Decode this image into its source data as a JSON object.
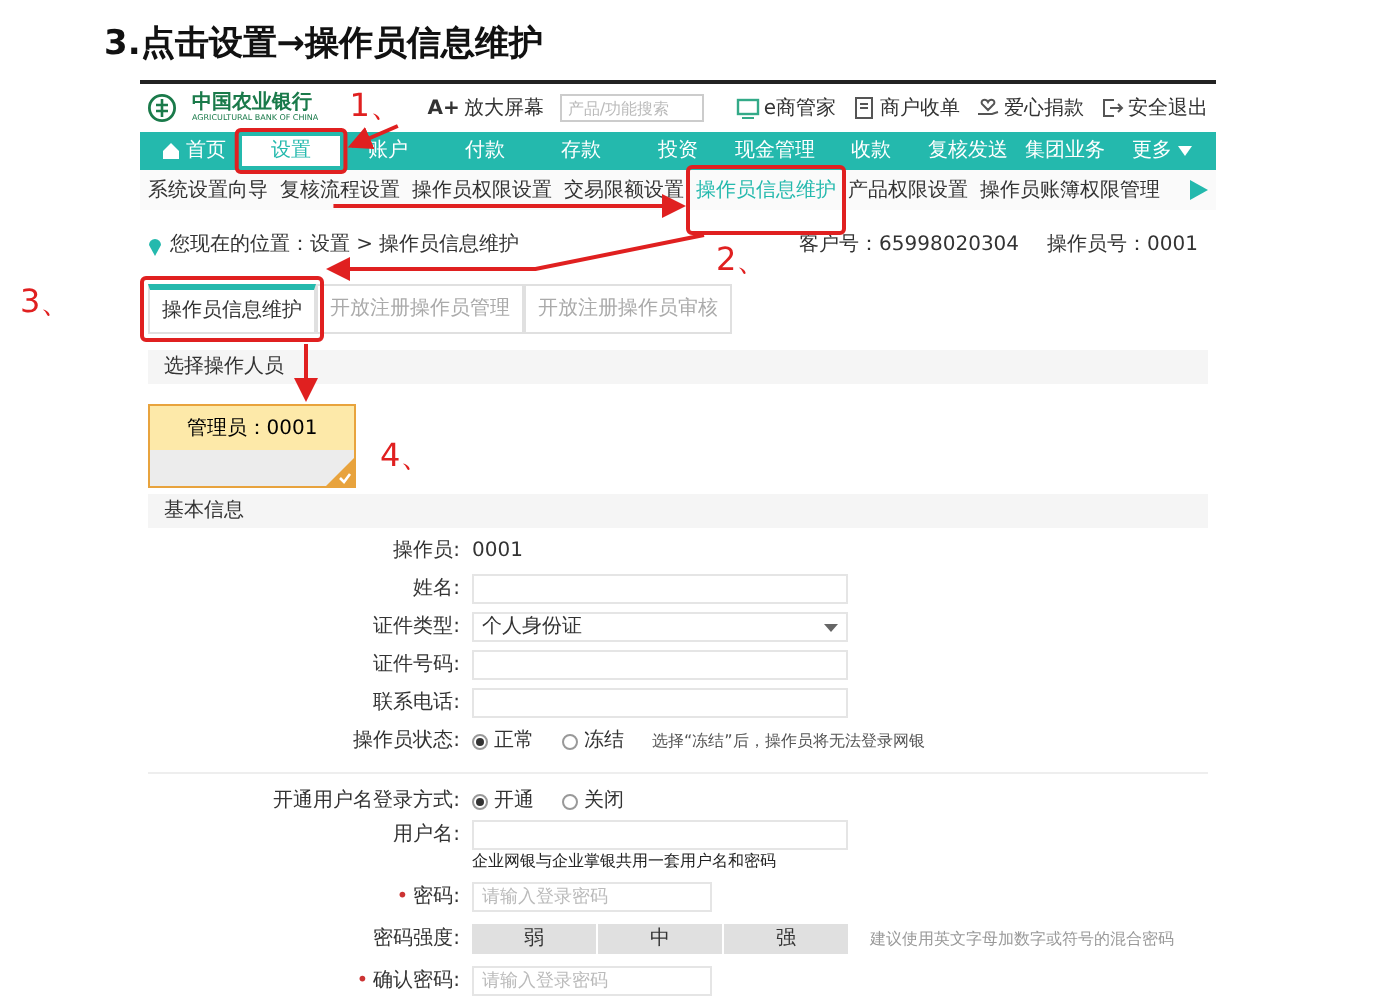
{
  "page_title": "3.点击设置→操作员信息维护",
  "header": {
    "bank_name": "中国农业银行",
    "bank_name_en": "AGRICULTURAL BANK OF CHINA",
    "zoom_mark": "A+",
    "zoom_label": "放大屏幕",
    "search": {
      "placeholder": "产品/功能搜索"
    },
    "links": [
      {
        "kind": "emanager",
        "label": "e商管家"
      },
      {
        "kind": "merchant",
        "label": "商户收单"
      },
      {
        "kind": "donate",
        "label": "爱心捐款"
      },
      {
        "kind": "logout",
        "label": "安全退出"
      }
    ]
  },
  "nav": {
    "home": "首页",
    "more": "更多",
    "items": [
      {
        "label": "设置",
        "selected": true
      },
      {
        "label": "账户",
        "selected": false
      },
      {
        "label": "付款",
        "selected": false
      },
      {
        "label": "存款",
        "selected": false
      },
      {
        "label": "投资",
        "selected": false
      },
      {
        "label": "现金管理",
        "selected": false
      },
      {
        "label": "收款",
        "selected": false
      },
      {
        "label": "复核发送",
        "selected": false
      },
      {
        "label": "集团业务",
        "selected": false
      }
    ]
  },
  "subnav": [
    {
      "label": "系统设置向导",
      "selected": false
    },
    {
      "label": "复核流程设置",
      "selected": false
    },
    {
      "label": "操作员权限设置",
      "selected": false
    },
    {
      "label": "交易限额设置",
      "selected": false
    },
    {
      "label": "操作员信息维护",
      "selected": true
    },
    {
      "label": "产品权限设置",
      "selected": false
    },
    {
      "label": "操作员账簿权限管理",
      "selected": false
    }
  ],
  "breadcrumb": {
    "label": "您现在的位置：设置 > 操作员信息维护",
    "customer_no": "客户号：65998020304",
    "operator_no": "操作员号：0001"
  },
  "tabs": [
    {
      "label": "操作员信息维护",
      "selected": true
    },
    {
      "label": "开放注册操作员管理",
      "selected": false
    },
    {
      "label": "开放注册操作员审核",
      "selected": false
    }
  ],
  "select_section": {
    "title": "选择操作人员",
    "operators": [
      {
        "label": "管理员：0001",
        "selected": true
      }
    ]
  },
  "basic_info": {
    "title": "基本信息",
    "fields": [
      {
        "kind": "text",
        "label": "操作员:",
        "value": "0001"
      },
      {
        "kind": "input",
        "label": "姓名:"
      },
      {
        "kind": "select",
        "label": "证件类型:",
        "value": "个人身份证"
      },
      {
        "kind": "input",
        "label": "证件号码:"
      },
      {
        "kind": "input",
        "label": "联系电话:"
      },
      {
        "kind": "radio",
        "label": "操作员状态:",
        "options": [
          {
            "label": "正常",
            "selected": true
          },
          {
            "label": "冻结",
            "selected": false
          }
        ],
        "note": "选择“冻结”后，操作员将无法登录网银"
      }
    ]
  },
  "login_section": {
    "fields": [
      {
        "kind": "radio",
        "label": "开通用户名登录方式:",
        "options": [
          {
            "label": "开通",
            "selected": true
          },
          {
            "label": "关闭",
            "selected": false
          }
        ]
      },
      {
        "kind": "input",
        "label": "用户名:",
        "hint": "企业网银与企业掌银共用一套用户名和密码"
      },
      {
        "kind": "password",
        "label": "密码:",
        "required_mark": "•",
        "placeholder": "请输入登录密码"
      },
      {
        "kind": "strength",
        "label": "密码强度:",
        "levels": [
          "弱",
          "中",
          "强"
        ],
        "note": "建议使用英文字母加数字或符号的混合密码"
      },
      {
        "kind": "password",
        "label": "确认密码:",
        "required_mark": "•",
        "placeholder": "请输入登录密码"
      }
    ]
  },
  "annotations": [
    {
      "label": "1、"
    },
    {
      "label": "2、"
    },
    {
      "label": "3、"
    },
    {
      "label": "4、"
    }
  ]
}
